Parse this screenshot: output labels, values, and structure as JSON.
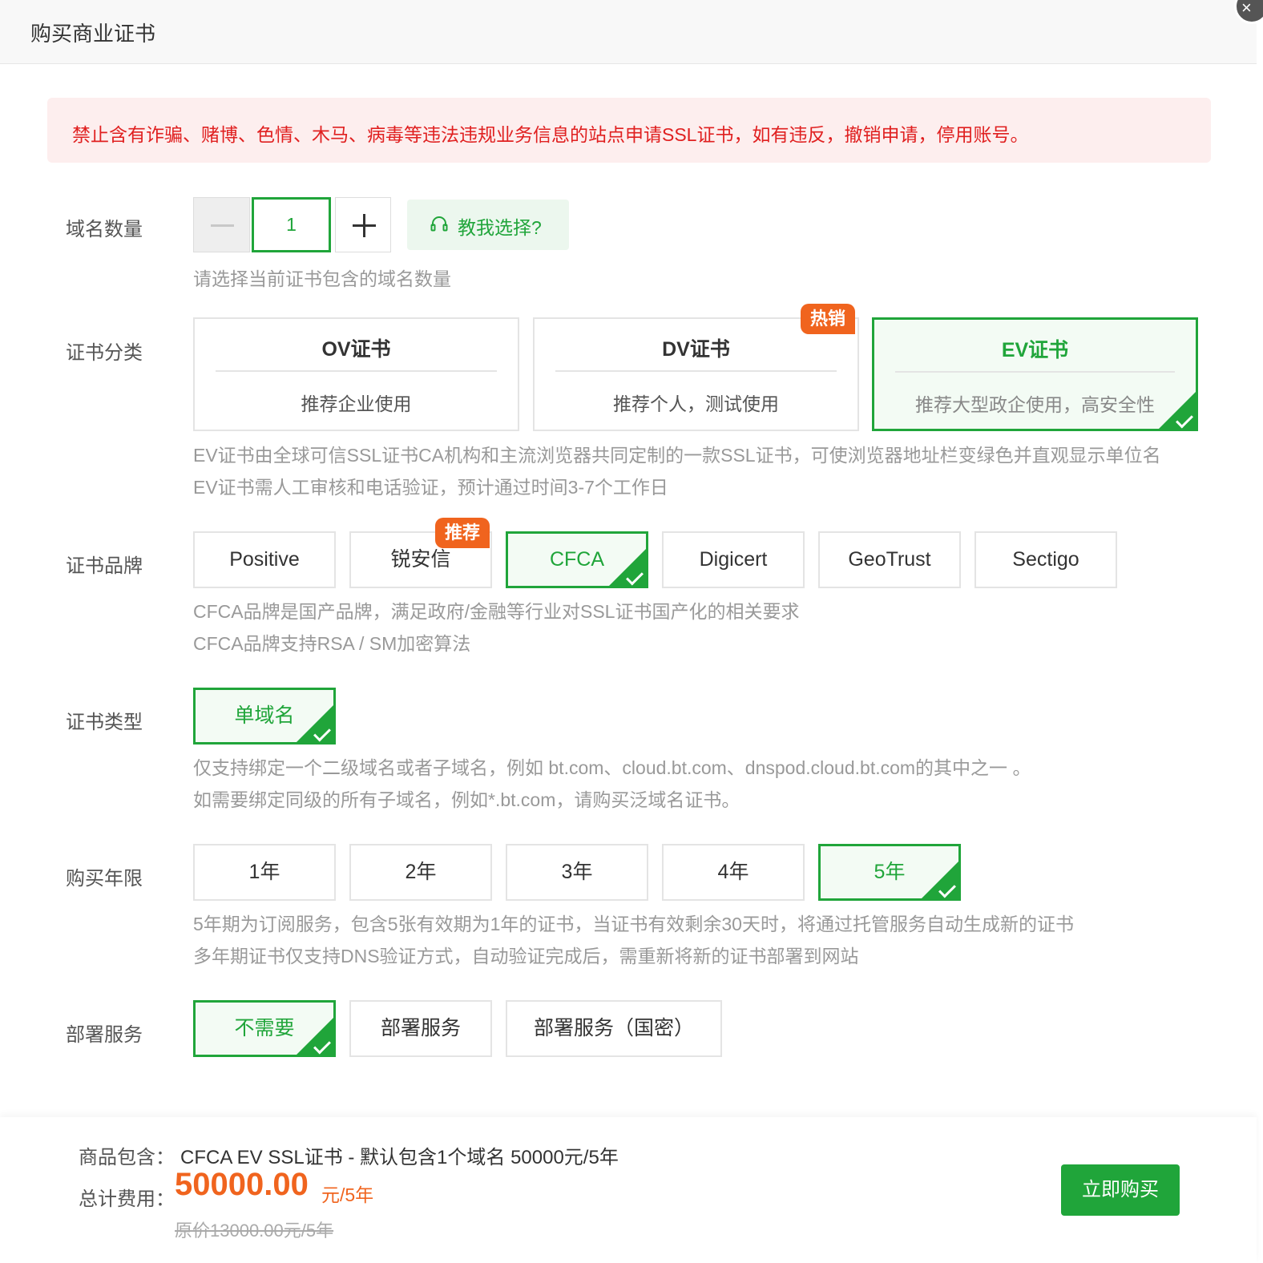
{
  "dialog": {
    "title": "购买商业证书",
    "close_icon": "close-icon"
  },
  "alert": {
    "text": "禁止含有诈骗、赌博、色情、木马、病毒等违法违规业务信息的站点申请SSL证书，如有违反，撤销申请，停用账号。",
    "color": "#e02020"
  },
  "domain_count": {
    "label": "域名数量",
    "value": "1",
    "teach_label": "教我选择?",
    "hint": "请选择当前证书包含的域名数量"
  },
  "category": {
    "label": "证书分类",
    "options": [
      {
        "name": "OV证书",
        "desc": "推荐企业使用"
      },
      {
        "name": "DV证书",
        "desc": "推荐个人，测试使用",
        "badge": "热销"
      },
      {
        "name": "EV证书",
        "desc": "推荐大型政企使用，高安全性"
      }
    ],
    "selected": "EV证书",
    "hint1": "EV证书由全球可信SSL证书CA机构和主流浏览器共同定制的一款SSL证书，可使浏览器地址栏变绿色并直观显示单位名",
    "hint2": "EV证书需人工审核和电话验证，预计通过时间3-7个工作日"
  },
  "brand": {
    "label": "证书品牌",
    "options": [
      "Positive",
      "锐安信",
      "CFCA",
      "Digicert",
      "GeoTrust",
      "Sectigo"
    ],
    "badge": "推荐",
    "selected": "CFCA",
    "hint1": "CFCA品牌是国产品牌，满足政府/金融等行业对SSL证书国产化的相关要求",
    "hint2": "CFCA品牌支持RSA / SM加密算法"
  },
  "cert_type": {
    "label": "证书类型",
    "options": [
      "单域名"
    ],
    "selected": "单域名",
    "hint1": "仅支持绑定一个二级域名或者子域名，例如 bt.com、cloud.bt.com、dnspod.cloud.bt.com的其中之一 。",
    "hint2": "如需要绑定同级的所有子域名，例如*.bt.com，请购买泛域名证书。"
  },
  "years": {
    "label": "购买年限",
    "options": [
      "1年",
      "2年",
      "3年",
      "4年",
      "5年"
    ],
    "selected": "5年",
    "hint1": "5年期为订阅服务，包含5张有效期为1年的证书，当证书有效剩余30天时，将通过托管服务自动生成新的证书",
    "hint2": "多年期证书仅支持DNS验证方式，自动验证完成后，需重新将新的证书部署到网站"
  },
  "deploy": {
    "label": "部署服务",
    "options": [
      "不需要",
      "部署服务",
      "部署服务（国密）"
    ],
    "selected": "不需要"
  },
  "footer": {
    "product_label": "商品包含：",
    "product_value": "CFCA EV SSL证书 - 默认包含1个域名 50000元/5年",
    "total_label": "总计费用：",
    "price": "50000.00",
    "price_unit": "元/5年",
    "original": "原价13000.00元/5年",
    "buy_label": "立即购买"
  },
  "colors": {
    "accent": "#20a53a",
    "badge": "#f0641e",
    "price": "#f0641e"
  }
}
